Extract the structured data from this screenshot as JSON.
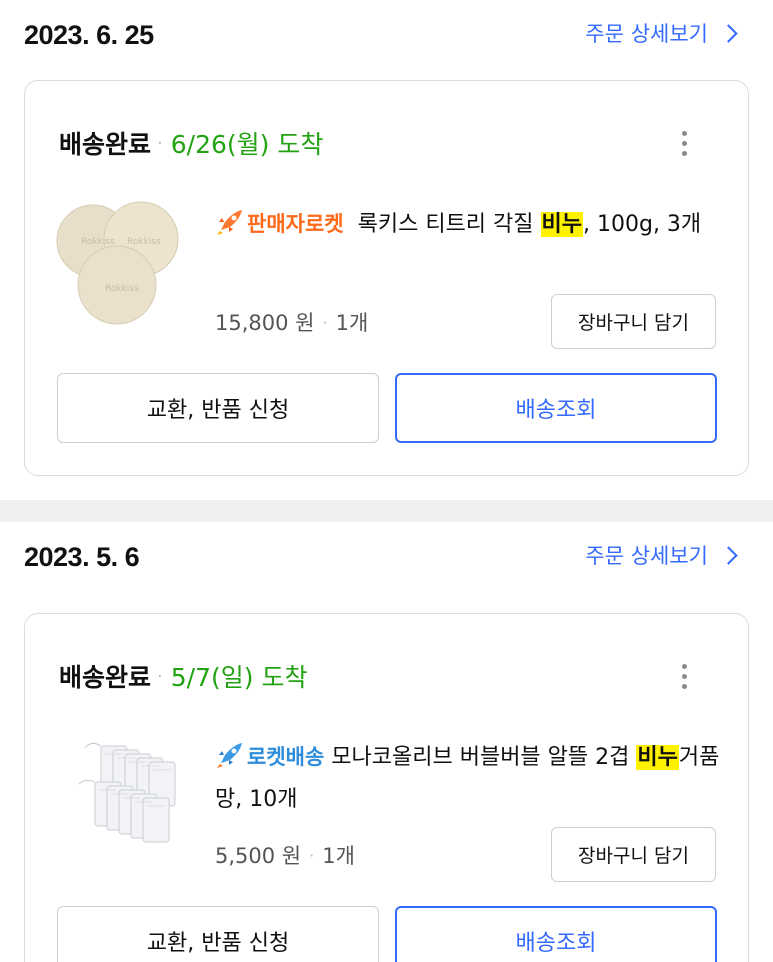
{
  "orders": [
    {
      "date": "2023. 6. 25",
      "detail_link": "주문 상세보기",
      "status": "배송완료",
      "arrival": "6/26(월) 도착",
      "badge": "판매자로켓",
      "product_before": "록키스 티트리 각질 ",
      "highlight": "비누",
      "product_after": ", 100g, 3개",
      "price": "15,800 원",
      "quantity": "1개",
      "cart_button": "장바구니 담기",
      "exchange_button": "교환, 반품 신청",
      "track_button": "배송조회",
      "thumb_text": "Rokkiss"
    },
    {
      "date": "2023. 5. 6",
      "detail_link": "주문 상세보기",
      "status": "배송완료",
      "arrival": "5/7(일) 도착",
      "badge": "로켓배송",
      "product_before": " 모나코올리브 버블버블 알뜰 2겹 ",
      "highlight": "비누",
      "product_after": "거품망, 10개",
      "price": "5,500 원",
      "quantity": "1개",
      "cart_button": "장바구니 담기",
      "exchange_button": "교환, 반품 신청",
      "track_button": "배송조회"
    }
  ],
  "colors": {
    "link_blue": "#346aff",
    "arrival_green": "#23a313",
    "seller_rocket_orange": "#ff6a1a",
    "rocket_blue": "#2f8edb",
    "highlight_yellow": "#fff200"
  },
  "icons": [
    "chevron-right-icon",
    "more-vertical-icon",
    "rocket-icon"
  ]
}
